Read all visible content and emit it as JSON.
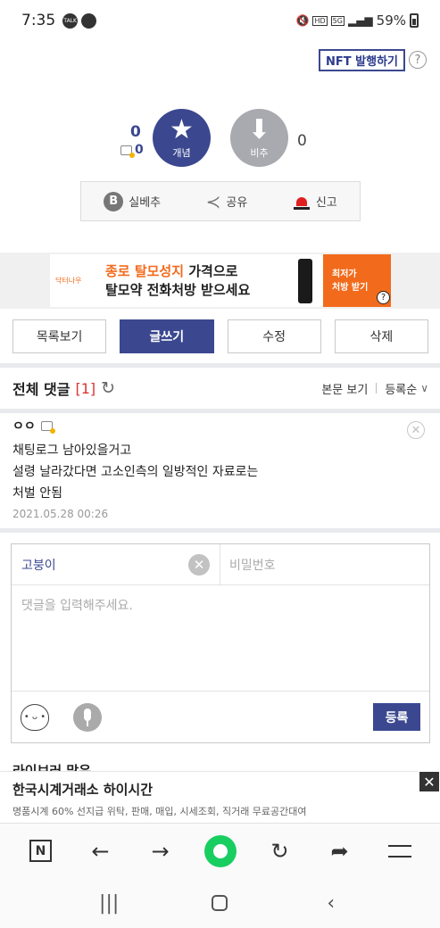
{
  "status_bar": {
    "time": "7:35",
    "notif_1": "TALK",
    "battery": "59%"
  },
  "header": {
    "nft_button": "NFT 발행하기",
    "help": "?"
  },
  "vote": {
    "up_count": "0",
    "up_sub_count": "0",
    "up_label": "개념",
    "down_label": "비추",
    "down_count": "0"
  },
  "actions": [
    {
      "badge": "B",
      "label": "실베추"
    },
    {
      "label": "공유"
    },
    {
      "label": "신고"
    }
  ],
  "ad_banner": {
    "logo": "닥터나우",
    "line1_highlight": "종로 탈모성지",
    "line1_rest": " 가격으로",
    "line2": "탈모약 전화처방 받으세요",
    "cta": "최저가\n처방 받기",
    "info": "?"
  },
  "buttons": [
    "목록보기",
    "글쓰기",
    "수정",
    "삭제"
  ],
  "comments_header": {
    "title": "전체 댓글",
    "count": "[1]",
    "view_body": "본문 보기",
    "sort": "등록순"
  },
  "comment": {
    "author": "ㅇㅇ",
    "lines": [
      "채팅로그 남아있을거고",
      "설령 날라갔다면 고소인측의 일방적인 자료로는",
      "처벌 안됨"
    ],
    "date": "2021.05.28 00:26"
  },
  "write_box": {
    "nickname": "고붕이",
    "password_placeholder": "비밀번호",
    "comment_placeholder": "댓글을 입력해주세요.",
    "submit": "등록"
  },
  "peek_section": "라이브러 많은",
  "bottom_ad": {
    "title": "한국시계거래소 하이시간",
    "subtitle": "명품시계 60% 선지급 위탁, 판매, 매입, 시세조회, 직거래 무료공간대여"
  },
  "browser_nav": {
    "n_label": "N"
  },
  "colors": {
    "primary": "#3b4890",
    "accent_orange": "#f26b1d",
    "count_red": "#dd3333",
    "naver_green": "#19ce60"
  }
}
